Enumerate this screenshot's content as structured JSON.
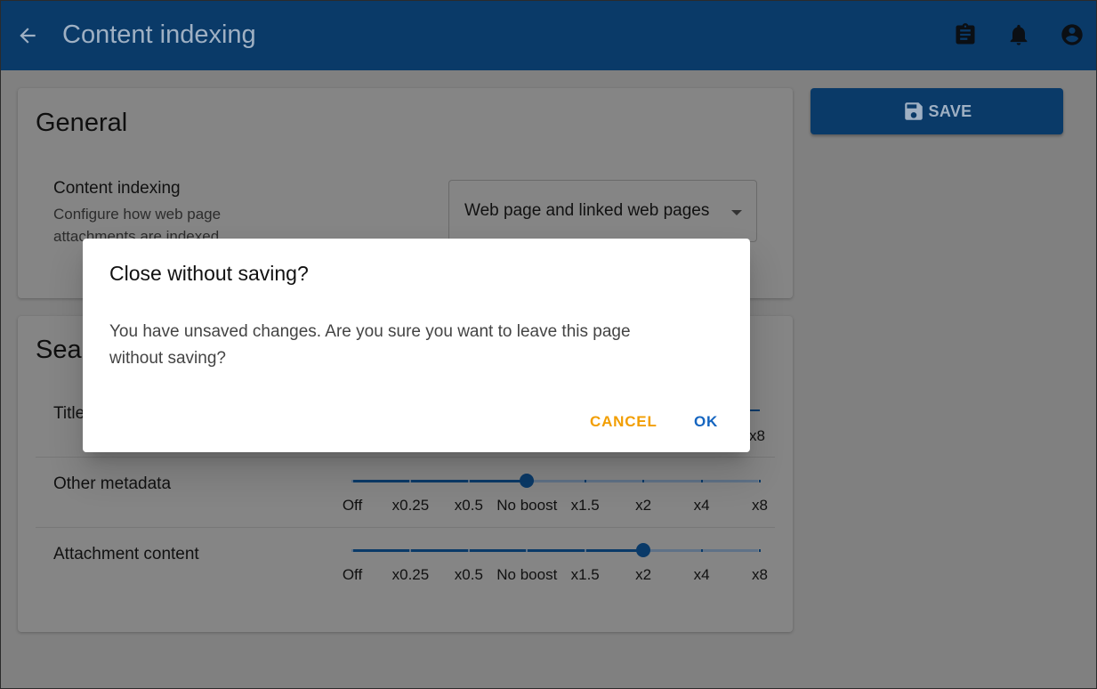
{
  "header": {
    "title": "Content indexing",
    "back_icon": "arrow-back-icon",
    "icons": [
      "clipboard-icon",
      "bell-icon",
      "account-circle-icon"
    ]
  },
  "toolbar": {
    "save_label": "SAVE",
    "save_icon": "floppy-disk-icon"
  },
  "general": {
    "heading": "General",
    "content_indexing": {
      "label": "Content indexing",
      "description_line1": "Configure how web page",
      "description_line2": "attachments are indexed",
      "selected": "Web page and linked web pages"
    }
  },
  "search": {
    "heading_visible": "Sear",
    "marks": [
      "Off",
      "x0.25",
      "x0.5",
      "No boost",
      "x1.5",
      "x2",
      "x4",
      "x8"
    ],
    "rows": [
      {
        "label_visible": "Title",
        "value_index": 7
      },
      {
        "label": "Other metadata",
        "value": "No boost",
        "value_index": 3
      },
      {
        "label": "Attachment content",
        "value": "x2",
        "value_index": 5
      }
    ]
  },
  "dialog": {
    "title": "Close without saving?",
    "message": "You have unsaved changes. Are you sure you want to leave this page without saving?",
    "cancel_label": "CANCEL",
    "ok_label": "OK"
  },
  "colors": {
    "primary": "#0a3a68",
    "cancel": "#f29e00",
    "ok": "#1565c0",
    "scrim_background": "#808080"
  }
}
